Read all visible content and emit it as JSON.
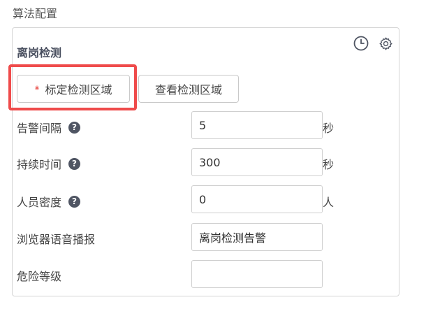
{
  "section_title": "算法配置",
  "panel": {
    "title": "离岗检测"
  },
  "icons": {
    "history": "clock-icon",
    "settings": "gear-icon"
  },
  "colors": {
    "highlight_border": "#ef4b4b",
    "required_mark": "#e5322d",
    "help_icon": "#4f5563"
  },
  "buttons": {
    "calibrate": {
      "required_mark": "*",
      "label": "标定检测区域"
    },
    "view": {
      "label": "查看检测区域"
    }
  },
  "fields": [
    {
      "label": "告警间隔",
      "has_help": true,
      "value": "5",
      "unit": "秒"
    },
    {
      "label": "持续时间",
      "has_help": true,
      "value": "300",
      "unit": "秒"
    },
    {
      "label": "人员密度",
      "has_help": true,
      "value": "0",
      "unit": "人"
    },
    {
      "label": "浏览器语音播报",
      "has_help": false,
      "value": "离岗检测告警",
      "unit": ""
    },
    {
      "label": "危险等级",
      "has_help": false,
      "value": "",
      "unit": ""
    }
  ]
}
